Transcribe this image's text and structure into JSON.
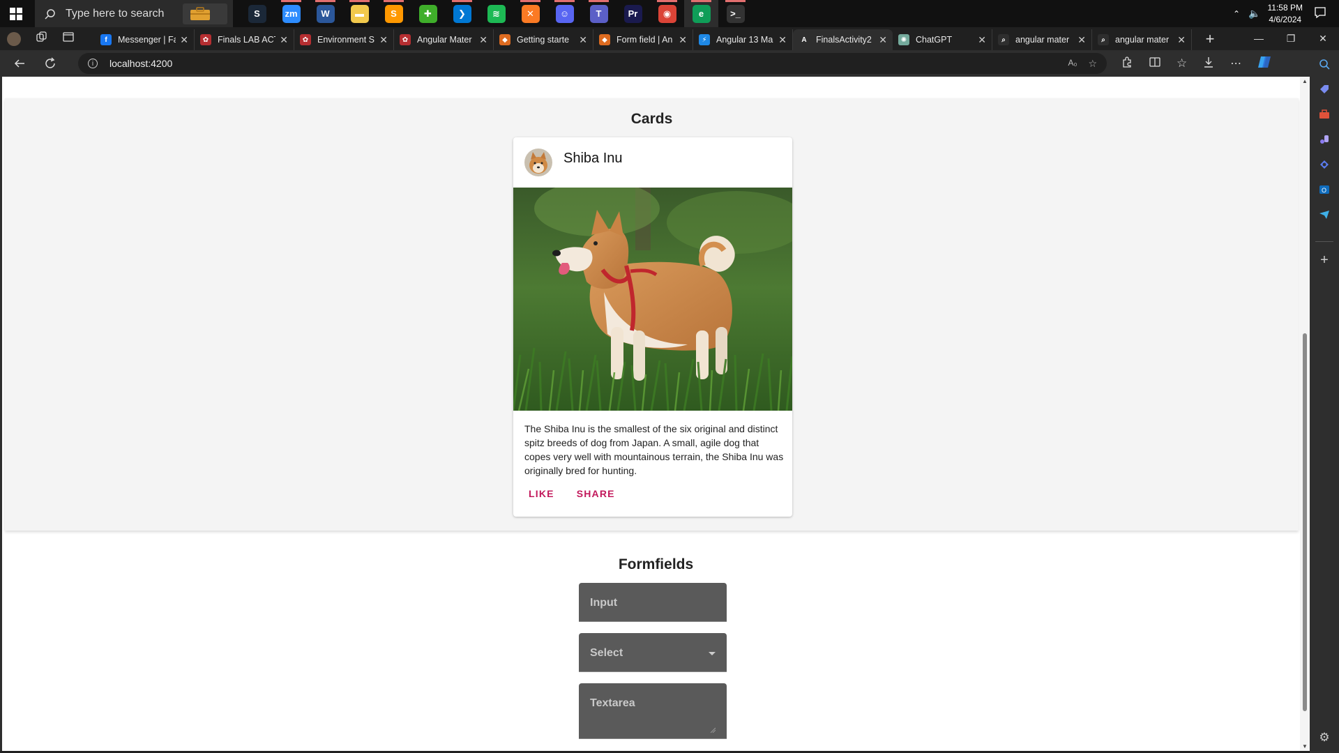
{
  "taskbar": {
    "search_placeholder": "Type here to search",
    "time": "11:58 PM",
    "date": "4/6/2024",
    "apps": [
      {
        "name": "steam-icon",
        "color": "#1b2838"
      },
      {
        "name": "zoom-icon",
        "color": "#2d8cff"
      },
      {
        "name": "word-icon",
        "color": "#2b579a"
      },
      {
        "name": "file-explorer-icon",
        "color": "#f2c94c"
      },
      {
        "name": "sublime-icon",
        "color": "#ff9800"
      },
      {
        "name": "node-icon",
        "color": "#3fae2a"
      },
      {
        "name": "vscode-icon",
        "color": "#0078d4"
      },
      {
        "name": "spotify-icon",
        "color": "#1db954"
      },
      {
        "name": "xampp-icon",
        "color": "#fb7a24"
      },
      {
        "name": "discord-icon",
        "color": "#5865f2"
      },
      {
        "name": "teams-icon",
        "color": "#5b5fc7"
      },
      {
        "name": "premiere-icon",
        "color": "#1a1a4e"
      },
      {
        "name": "chrome-icon",
        "color": "#db4437"
      },
      {
        "name": "edge-icon",
        "color": "#0f9d58"
      },
      {
        "name": "terminal-icon",
        "color": "#333333"
      }
    ]
  },
  "browser": {
    "tabs": [
      {
        "title": "Messenger | Fa",
        "favicon_color": "#1877f2",
        "icon": "facebook-icon"
      },
      {
        "title": "Finals LAB ACT",
        "favicon_color": "#b52e31",
        "icon": "angular-material-icon"
      },
      {
        "title": "Environment S",
        "favicon_color": "#b52e31",
        "icon": "angular-material-icon"
      },
      {
        "title": "Angular Mater",
        "favicon_color": "#b52e31",
        "icon": "angular-material-icon"
      },
      {
        "title": "Getting starte",
        "favicon_color": "#dd6b20",
        "icon": "shield-icon"
      },
      {
        "title": "Form field | An",
        "favicon_color": "#dd6b20",
        "icon": "shield-icon"
      },
      {
        "title": "Angular 13 Ma",
        "favicon_color": "#1e88e5",
        "icon": "bolt-icon"
      },
      {
        "title": "FinalsActivity2",
        "favicon_color": "#2e2e2e",
        "icon": "angular-icon",
        "active": true
      },
      {
        "title": "ChatGPT",
        "favicon_color": "#74aa9c",
        "icon": "chatgpt-icon"
      },
      {
        "title": "angular mater",
        "favicon_color": "#2e2e2e",
        "icon": "search-icon"
      },
      {
        "title": "angular mater",
        "favicon_color": "#2e2e2e",
        "icon": "search-icon"
      }
    ],
    "url": "localhost:4200"
  },
  "page": {
    "cards_heading": "Cards",
    "card": {
      "title": "Shiba Inu",
      "text": "The Shiba Inu is the smallest of the six original and distinct spitz breeds of dog from Japan. A small, agile dog that copes very well with mountainous terrain, the Shiba Inu was originally bred for hunting.",
      "like_label": "LIKE",
      "share_label": "SHARE",
      "accent_color": "#c2185b"
    },
    "formfields_heading": "Formfields",
    "input_label": "Input",
    "select_label": "Select",
    "textarea_label": "Textarea"
  }
}
